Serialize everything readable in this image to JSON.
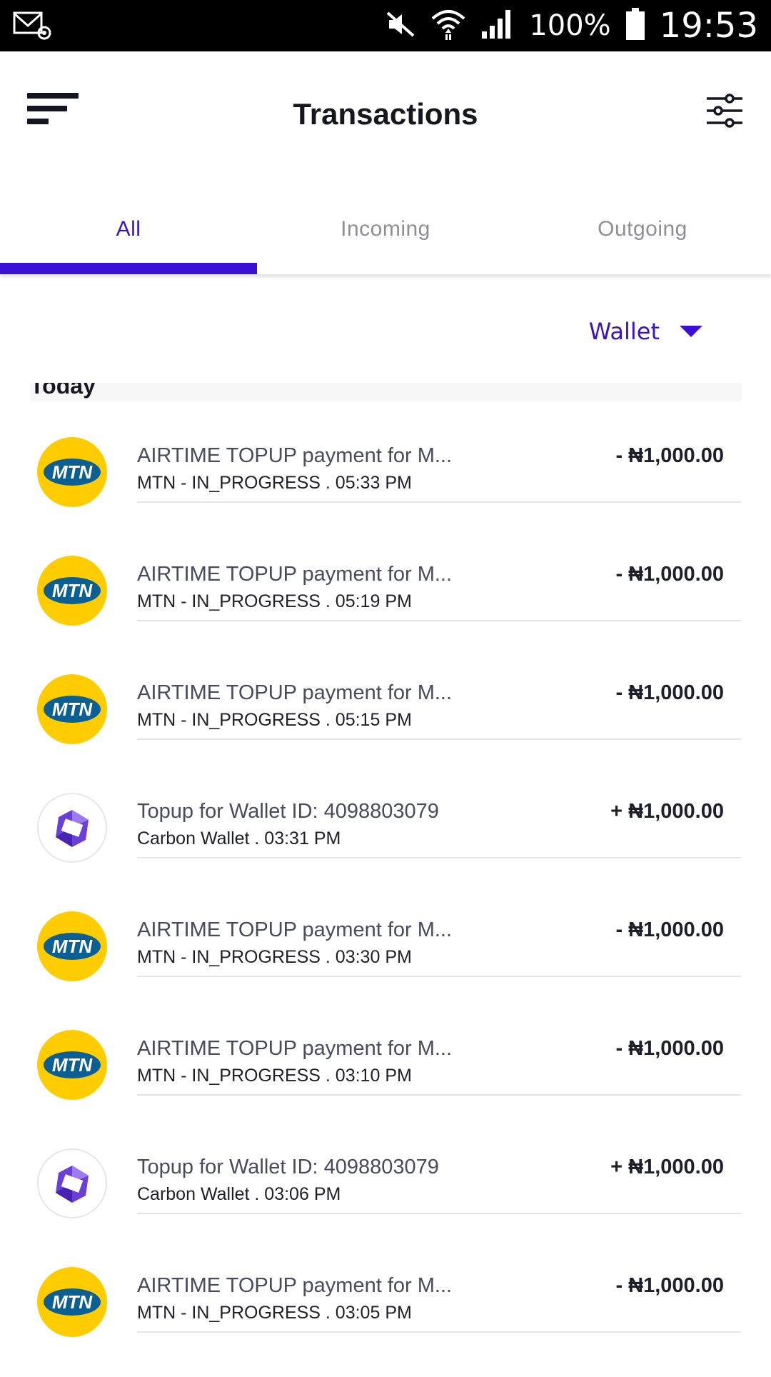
{
  "status_bar": {
    "battery_percent": "100%",
    "time": "19:53",
    "icons": [
      "email-notification-icon",
      "muted-icon",
      "wifi-icon",
      "cell-signal-icon",
      "battery-icon"
    ]
  },
  "header": {
    "title": "Transactions",
    "menu_icon": "menu-icon",
    "filter_icon": "sliders-icon"
  },
  "tabs": [
    {
      "label": "All",
      "active": true
    },
    {
      "label": "Incoming",
      "active": false
    },
    {
      "label": "Outgoing",
      "active": false
    }
  ],
  "wallet_selector": {
    "label": "Wallet",
    "icon": "caret-down-icon"
  },
  "section": {
    "label": "Today"
  },
  "transactions": [
    {
      "icon": "mtn-logo",
      "title": "AIRTIME TOPUP payment for M...",
      "subtitle": "MTN - IN_PROGRESS . 05:33 PM",
      "amount": "- ₦1,000.00"
    },
    {
      "icon": "mtn-logo",
      "title": "AIRTIME TOPUP payment for M...",
      "subtitle": "MTN - IN_PROGRESS . 05:19 PM",
      "amount": "- ₦1,000.00"
    },
    {
      "icon": "mtn-logo",
      "title": "AIRTIME TOPUP payment for M...",
      "subtitle": "MTN - IN_PROGRESS . 05:15 PM",
      "amount": "- ₦1,000.00"
    },
    {
      "icon": "carbon-logo",
      "title": "Topup for Wallet ID: 4098803079",
      "subtitle": "Carbon Wallet . 03:31 PM",
      "amount": "+ ₦1,000.00"
    },
    {
      "icon": "mtn-logo",
      "title": "AIRTIME TOPUP payment for M...",
      "subtitle": "MTN - IN_PROGRESS . 03:30 PM",
      "amount": "- ₦1,000.00"
    },
    {
      "icon": "mtn-logo",
      "title": "AIRTIME TOPUP payment for M...",
      "subtitle": "MTN - IN_PROGRESS . 03:10 PM",
      "amount": "- ₦1,000.00"
    },
    {
      "icon": "carbon-logo",
      "title": "Topup for Wallet ID: 4098803079",
      "subtitle": "Carbon Wallet . 03:06 PM",
      "amount": "+ ₦1,000.00"
    },
    {
      "icon": "mtn-logo",
      "title": "AIRTIME TOPUP payment for M...",
      "subtitle": "MTN - IN_PROGRESS . 03:05 PM",
      "amount": "- ₦1,000.00"
    }
  ],
  "logos": {
    "mtn_text": "MTN"
  },
  "colors": {
    "accent": "#3b0fd4",
    "mtn_yellow": "#ffcc00",
    "mtn_blue": "#0b5f92",
    "carbon_purple": "#6a3fd8"
  }
}
